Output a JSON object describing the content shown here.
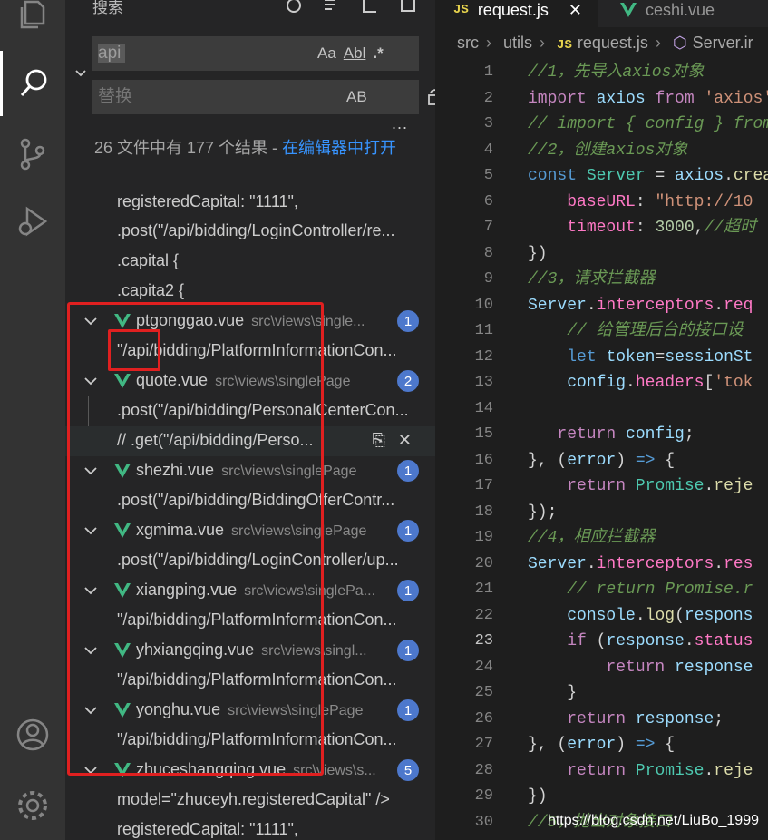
{
  "sidebar": {
    "title": "搜索",
    "search": {
      "value": "api",
      "options": [
        "Aa",
        "Abl",
        ".*"
      ]
    },
    "replace": {
      "placeholder": "替换",
      "option": "AB"
    },
    "more": "...",
    "summary_text": "26 文件中有 177 个结果 - ",
    "summary_link": "在编辑器中打开",
    "pre_lines": [
      "registeredCapital: \"1111\",",
      ".post(\"/api/bidding/LoginController/re...",
      ".capital {",
      ".capita2 {"
    ],
    "files": [
      {
        "name": "ptgonggao.vue",
        "path": "src\\views\\single...",
        "count": "1",
        "matches": [
          "\"/api/bidding/PlatformInformationCon..."
        ]
      },
      {
        "name": "quote.vue",
        "path": "src\\views\\singlePage",
        "count": "2",
        "matches": [
          ".post(\"/api/bidding/PersonalCenterCon...",
          "//   .get(\"/api/bidding/Perso..."
        ]
      },
      {
        "name": "shezhi.vue",
        "path": "src\\views\\singlePage",
        "count": "1",
        "matches": [
          ".post(\"/api/bidding/BiddingOfferContr..."
        ]
      },
      {
        "name": "xgmima.vue",
        "path": "src\\views\\singlePage",
        "count": "1",
        "matches": [
          ".post(\"/api/bidding/LoginController/up..."
        ]
      },
      {
        "name": "xiangping.vue",
        "path": "src\\views\\singlePa...",
        "count": "1",
        "matches": [
          "\"/api/bidding/PlatformInformationCon..."
        ]
      },
      {
        "name": "yhxiangqing.vue",
        "path": "src\\views\\singl...",
        "count": "1",
        "matches": [
          "\"/api/bidding/PlatformInformationCon..."
        ]
      },
      {
        "name": "yonghu.vue",
        "path": "src\\views\\singlePage",
        "count": "1",
        "matches": [
          "\"/api/bidding/PlatformInformationCon..."
        ]
      },
      {
        "name": "zhuceshangqing.vue",
        "path": "src\\views\\s...",
        "count": "5",
        "matches": [
          "model=\"zhuceyh.registeredCapital\" />",
          "registeredCapital: \"1111\","
        ]
      }
    ]
  },
  "editor": {
    "tabs": [
      {
        "label": "request.js",
        "type": "JS",
        "active": true,
        "close": "✕"
      },
      {
        "label": "ceshi.vue",
        "type": "vue",
        "active": false
      }
    ],
    "breadcrumb": [
      "src",
      "utils",
      "request.js",
      "Server.ir"
    ],
    "current_line": 23,
    "line_numbers": [
      "1",
      "2",
      "3",
      "4",
      "5",
      "6",
      "7",
      "8",
      "9",
      "10",
      "11",
      "12",
      "13",
      "14",
      "15",
      "16",
      "17",
      "18",
      "19",
      "20",
      "21",
      "22",
      "23",
      "24",
      "25",
      "26",
      "27",
      "28",
      "29",
      "30"
    ]
  },
  "watermark": "https://blog.csdn.net/LiuBo_1999",
  "colors": {
    "accent": "#3794ff",
    "badge": "#4d78cc",
    "highlight_box": "#e02020"
  }
}
